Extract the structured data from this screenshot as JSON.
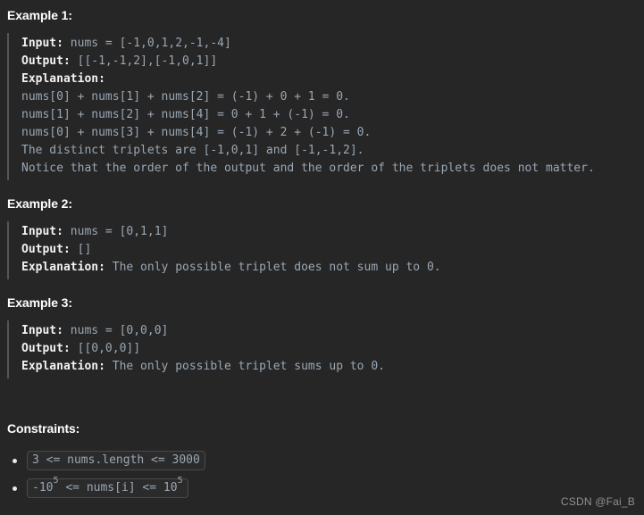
{
  "background_color": "#262626",
  "text_color": "#9aa7b4",
  "heading_color": "#ffffff",
  "quote_border_color": "#555555",
  "examples": [
    {
      "heading": "Example 1:",
      "lines": [
        {
          "label": "Input:",
          "code": " nums = [-1,0,1,2,-1,-4]"
        },
        {
          "label": "Output:",
          "code": " [[-1,-1,2],[-1,0,1]]"
        },
        {
          "label": "Explanation:",
          "code": ""
        },
        {
          "label": "",
          "code": "nums[0] + nums[1] + nums[2] = (-1) + 0 + 1 = 0."
        },
        {
          "label": "",
          "code": "nums[1] + nums[2] + nums[4] = 0 + 1 + (-1) = 0."
        },
        {
          "label": "",
          "code": "nums[0] + nums[3] + nums[4] = (-1) + 2 + (-1) = 0."
        },
        {
          "label": "",
          "code": "The distinct triplets are [-1,0,1] and [-1,-1,2]."
        },
        {
          "label": "",
          "code": "Notice that the order of the output and the order of the triplets does not matter."
        }
      ]
    },
    {
      "heading": "Example 2:",
      "lines": [
        {
          "label": "Input:",
          "code": " nums = [0,1,1]"
        },
        {
          "label": "Output:",
          "code": " []"
        },
        {
          "label": "Explanation:",
          "code": " The only possible triplet does not sum up to 0."
        }
      ]
    },
    {
      "heading": "Example 3:",
      "lines": [
        {
          "label": "Input:",
          "code": " nums = [0,0,0]"
        },
        {
          "label": "Output:",
          "code": " [[0,0,0]]"
        },
        {
          "label": "Explanation:",
          "code": " The only possible triplet sums up to 0."
        }
      ]
    }
  ],
  "constraints": {
    "heading": "Constraints:",
    "items": [
      {
        "parts": [
          {
            "type": "text",
            "value": "3 <= nums.length <= 3000"
          }
        ]
      },
      {
        "parts": [
          {
            "type": "text",
            "value": "-10"
          },
          {
            "type": "sup",
            "value": "5"
          },
          {
            "type": "text",
            "value": " <= nums[i] <= 10"
          },
          {
            "type": "sup",
            "value": "5"
          }
        ]
      }
    ]
  },
  "watermark": "CSDN @Fai_B"
}
